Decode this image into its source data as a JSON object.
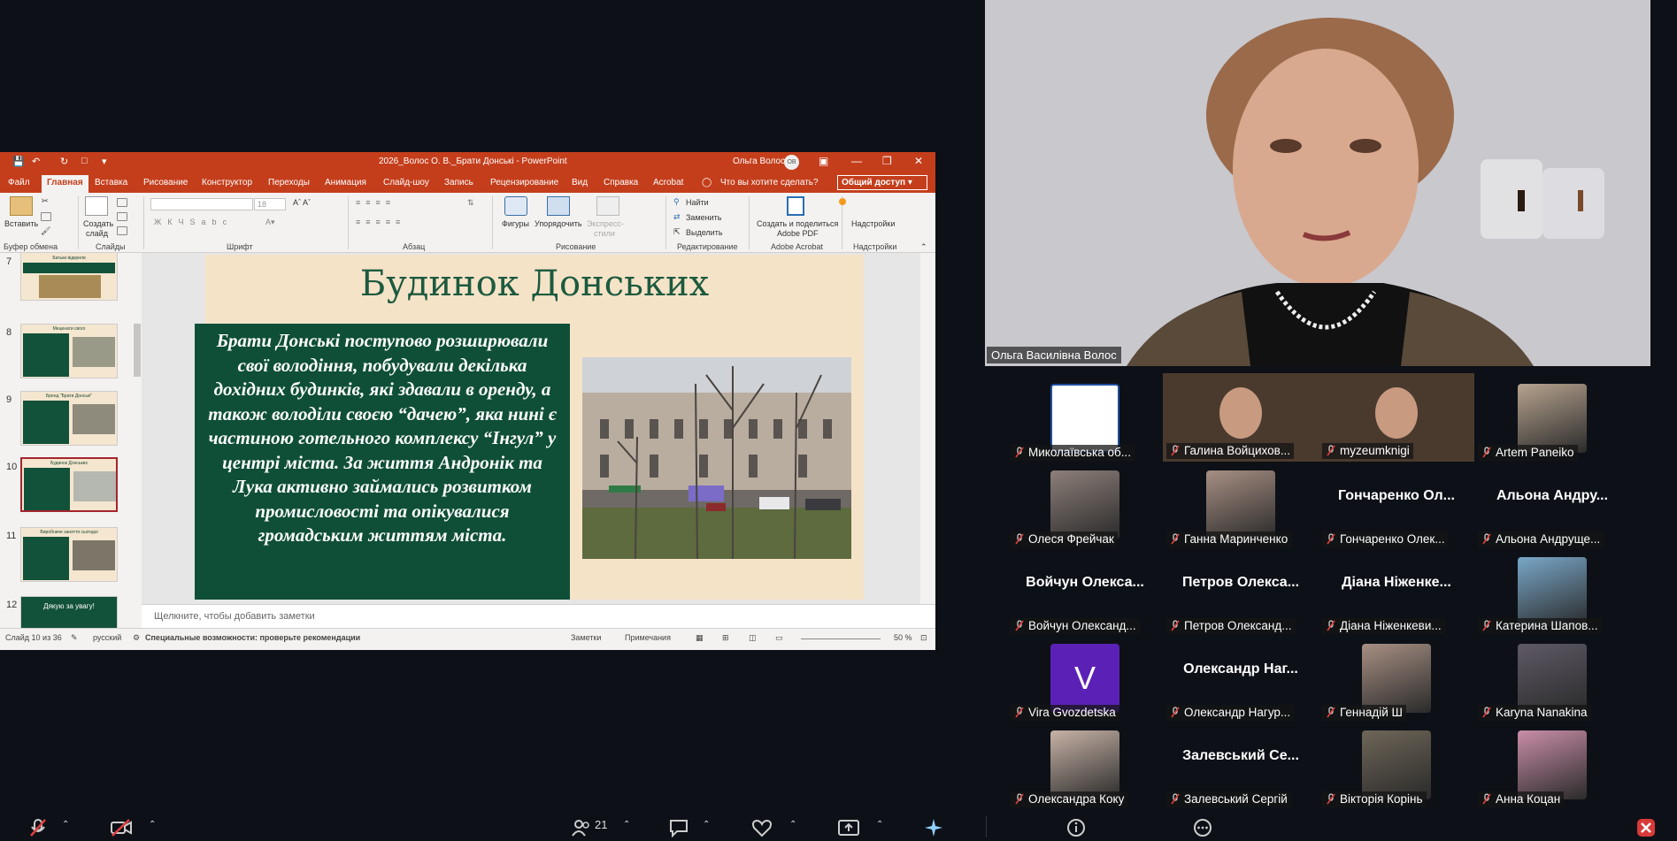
{
  "ppt": {
    "window_title": "2026_Волос О. В._Брати Донські  -  PowerPoint",
    "user_name": "Ольга Волос",
    "user_initials": "ОВ",
    "tabs": [
      "Файл",
      "Главная",
      "Вставка",
      "Рисование",
      "Конструктор",
      "Переходы",
      "Анимация",
      "Слайд-шоу",
      "Запись",
      "Рецензирование",
      "Вид",
      "Справка",
      "Acrobat"
    ],
    "active_tab": "Главная",
    "tell_me": "Что вы хотите сделать?",
    "share": "Общий доступ",
    "ribbon": {
      "paste": "Вставить",
      "create_slide_1": "Создать",
      "create_slide_2": "слайд",
      "font_size": "18",
      "shapes": "Фигуры",
      "arrange": "Упорядочить",
      "express_1": "Экспресс-",
      "express_2": "стили",
      "find": "Найти",
      "replace": "Заменить",
      "select": "Выделить",
      "adobe_1": "Создать и поделиться",
      "adobe_2": "Adobe PDF",
      "addins": "Надстройки"
    },
    "groups": [
      "Буфер обмена",
      "Слайды",
      "Шрифт",
      "Абзац",
      "Рисование",
      "Редактирование",
      "Adobe Acrobat",
      "Надстройки"
    ],
    "thumbnails": [
      {
        "num": "7",
        "title": "Батьки відкрили"
      },
      {
        "num": "8",
        "title": "Меценати свого"
      },
      {
        "num": "9",
        "title": "Бренд \"Брати Донські\""
      },
      {
        "num": "10",
        "title": "Будинок Донських"
      },
      {
        "num": "11",
        "title": "Виробниче заняття сьогодні"
      },
      {
        "num": "12",
        "title": "Дякую за увагу!"
      }
    ],
    "slide": {
      "title": "Будинок Донських",
      "body": "Брати Донські поступово розширювали свої володіння, побудували декілька дохідних будинків, які здавали в оренду, а також володіли своєю “дачею”, яка нині є частиною готельного комплексу “Інгул” у центрі міста. За життя Андронік та Лука активно займались розвитком промисловості та опікувалися громадським життям міста."
    },
    "notes_placeholder": "Щелкните, чтобы добавить заметки",
    "status": {
      "slide_of": "Слайд 10 из 36",
      "language": "русский",
      "accessibility": "Специальные возможности: проверьте рекомендации",
      "notes": "Заметки",
      "comments": "Примечания",
      "zoom": "50 %"
    }
  },
  "speaker": {
    "name": "Ольга Василівна Волос"
  },
  "participants": [
    {
      "name": "Миколаївська об...",
      "big": "",
      "avatar": "library-logo"
    },
    {
      "name": "Галина Войцихов...",
      "big": "",
      "avatar": "video"
    },
    {
      "name": "myzeumknigi",
      "big": "",
      "avatar": "video"
    },
    {
      "name": "Artem Paneiko",
      "big": "",
      "avatar": "photo"
    },
    {
      "name": "Олеся Фрейчак",
      "big": "",
      "avatar": "photo"
    },
    {
      "name": "Ганна Маринченко",
      "big": "",
      "avatar": "photo"
    },
    {
      "name": "Гончаренко Олек...",
      "big": "Гончаренко Ол...",
      "avatar": "none"
    },
    {
      "name": "Альона Андруще...",
      "big": "Альона Андру...",
      "avatar": "none"
    },
    {
      "name": "Войчун Олександ...",
      "big": "Войчун Олекса...",
      "avatar": "none"
    },
    {
      "name": "Петров Олександ...",
      "big": "Петров Олекса...",
      "avatar": "none"
    },
    {
      "name": "Діана Ніженкеви...",
      "big": "Діана Ніженке...",
      "avatar": "none"
    },
    {
      "name": "Катерина Шапов...",
      "big": "",
      "avatar": "photo"
    },
    {
      "name": "Vira Gvozdetska",
      "big": "",
      "avatar": "letter",
      "letter": "V"
    },
    {
      "name": "Олександр Нагур...",
      "big": "Олександр Наг...",
      "avatar": "none"
    },
    {
      "name": "Геннадій Ш",
      "big": "",
      "avatar": "photo"
    },
    {
      "name": "Karyna Nanakina",
      "big": "",
      "avatar": "photo"
    },
    {
      "name": "Олександра Коку",
      "big": "",
      "avatar": "photo"
    },
    {
      "name": "Залевський Сергій",
      "big": "Залевський Се...",
      "avatar": "none"
    },
    {
      "name": "Вікторія Корінь",
      "big": "",
      "avatar": "photo"
    },
    {
      "name": "Анна Коцан",
      "big": "",
      "avatar": "photo"
    }
  ],
  "toolbar": {
    "participant_count": "21"
  },
  "colors": {
    "ppt_accent": "#c43e1c",
    "slide_green": "#0f4f37",
    "muted_red": "#e04040"
  }
}
